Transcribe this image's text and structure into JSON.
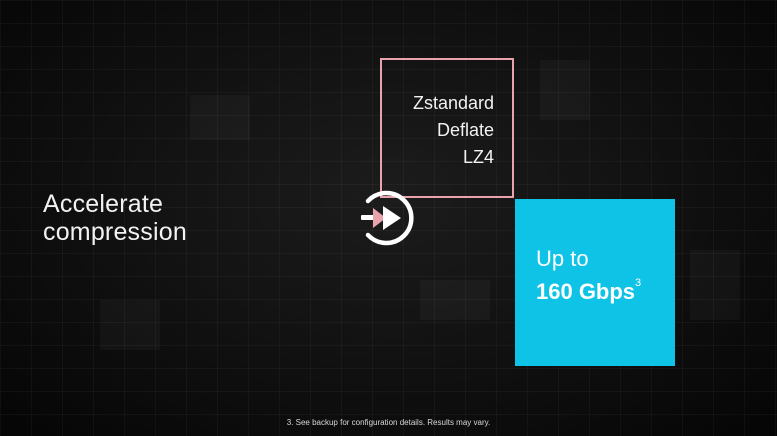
{
  "slide": {
    "headline_line1": "Accelerate",
    "headline_line2": "compression",
    "algorithms": [
      "Zstandard",
      "Deflate",
      "LZ4"
    ],
    "algorithm_border_color": "#e8a3ad",
    "speed_box": {
      "label": "Up to",
      "value": "160 Gbps",
      "footnote_ref": "3",
      "color": "#0ec3e6"
    },
    "footnote": "3. See backup for configuration details. Results may vary."
  },
  "player": {
    "play_icon": "play-circle-icon"
  }
}
